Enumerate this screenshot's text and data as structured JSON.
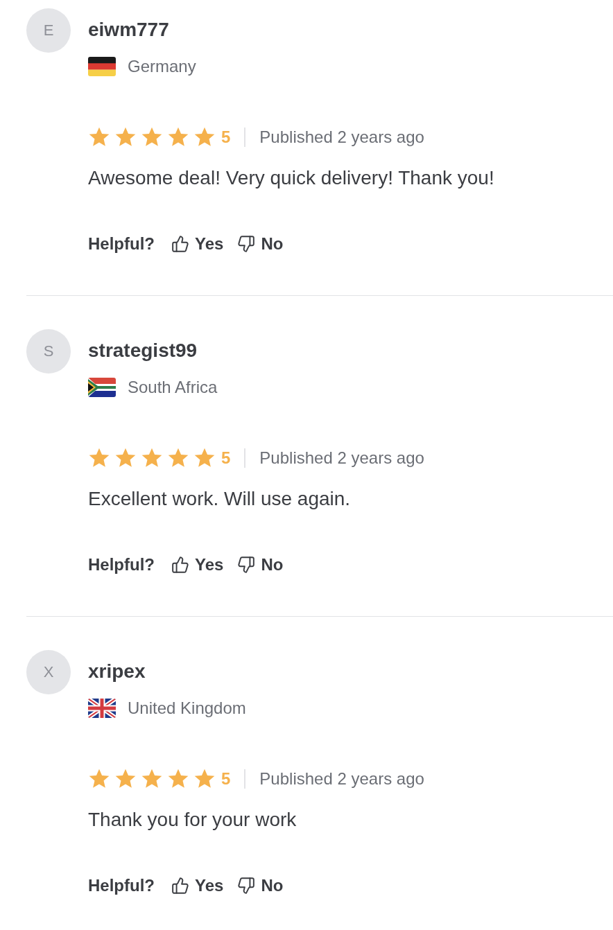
{
  "reviews": [
    {
      "avatar_letter": "E",
      "name": "eiwm777",
      "country": "Germany",
      "kind": "de",
      "stars": 5,
      "rating": "5",
      "published": "Published 2 years ago",
      "text": "Awesome deal! Very quick delivery! Thank you!",
      "helpful_label": "Helpful?",
      "yes": "Yes",
      "no": "No"
    },
    {
      "avatar_letter": "S",
      "name": "strategist99",
      "country": "South Africa",
      "kind": "za",
      "stars": 5,
      "rating": "5",
      "published": "Published 2 years ago",
      "text": "Excellent work. Will use again.",
      "helpful_label": "Helpful?",
      "yes": "Yes",
      "no": "No"
    },
    {
      "avatar_letter": "X",
      "name": "xripex",
      "country": "United Kingdom",
      "kind": "gb",
      "stars": 5,
      "rating": "5",
      "published": "Published 2 years ago",
      "text": "Thank you for your work",
      "helpful_label": "Helpful?",
      "yes": "Yes",
      "no": "No"
    }
  ]
}
